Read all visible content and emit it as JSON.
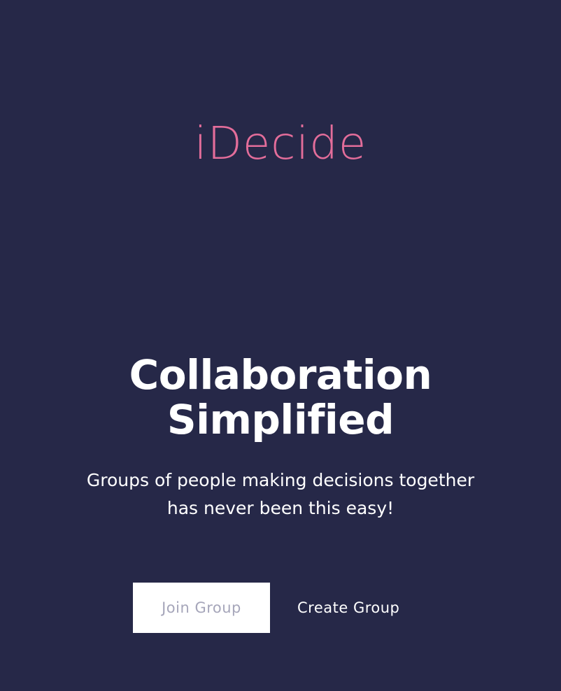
{
  "app": {
    "logo_text": "iDecide"
  },
  "hero": {
    "title_line1": "Collaboration",
    "title_line2": "Simplified",
    "subtitle_line1": "Groups of people making decisions together",
    "subtitle_line2": "has never been this easy!"
  },
  "actions": {
    "join_label": "Join Group",
    "create_label": "Create Group"
  },
  "colors": {
    "background": "#262848",
    "logo_accent": "#e36d9a",
    "text": "#ffffff",
    "join_button_bg": "#ffffff",
    "join_button_text": "#a6a6ba"
  }
}
